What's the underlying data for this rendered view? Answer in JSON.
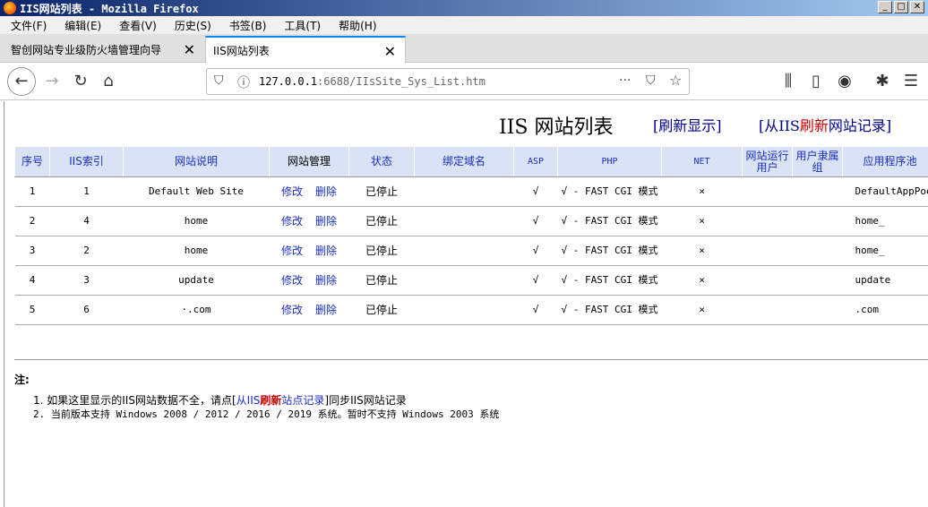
{
  "window": {
    "title": "IIS网站列表 - Mozilla Firefox",
    "min": "_",
    "max": "□",
    "close": "✕"
  },
  "menu": [
    "文件(F)",
    "编辑(E)",
    "查看(V)",
    "历史(S)",
    "书签(B)",
    "工具(T)",
    "帮助(H)"
  ],
  "tabs": [
    {
      "label": "智创网站专业级防火墙管理向导",
      "close": "✕"
    },
    {
      "label": "IIS网站列表",
      "close": "✕"
    }
  ],
  "newtab": "+",
  "nav": {
    "back": "←",
    "forward": "→",
    "reload": "↻",
    "home": "⌂",
    "url_host": "127.0.0.1",
    "url_rest": ":6688/IIsSite_Sys_List.htm",
    "more": "···",
    "pocket": "⛉",
    "star": "☆",
    "library": "⫼",
    "sidebar": "▯",
    "account": "◉",
    "gift": "✱",
    "menu": "☰"
  },
  "page": {
    "title": "IIS 网站列表",
    "refresh_link": "[刷新显示]",
    "sync_link_prefix": "[从IIS",
    "sync_link_red": "刷新",
    "sync_link_suffix": "网站记录]"
  },
  "table": {
    "headers": [
      "序号",
      "IIS索引",
      "网站说明",
      "网站管理",
      "状态",
      "绑定域名",
      "ASP",
      "PHP",
      "NET",
      "网站运行用户",
      "用户隶属组",
      "应用程序池"
    ],
    "edit_label": "修改",
    "delete_label": "删除",
    "rows": [
      {
        "no": "1",
        "iis": "1",
        "desc": "Default Web Site",
        "status": "已停止",
        "domain": "",
        "asp": "√",
        "php": "√ - FAST CGI 模式",
        "net": "×",
        "user": "",
        "group": "",
        "pool": "DefaultAppPool"
      },
      {
        "no": "2",
        "iis": "4",
        "desc": "home",
        "status": "已停止",
        "domain": "",
        "asp": "√",
        "php": "√ - FAST CGI 模式",
        "net": "×",
        "user": "",
        "group": "",
        "pool": "home_"
      },
      {
        "no": "3",
        "iis": "2",
        "desc": "home",
        "status": "已停止",
        "domain": "",
        "asp": "√",
        "php": "√ - FAST CGI 模式",
        "net": "×",
        "user": "",
        "group": "",
        "pool": "home_"
      },
      {
        "no": "4",
        "iis": "3",
        "desc": "update",
        "status": "已停止",
        "domain": "",
        "asp": "√",
        "php": "√ - FAST CGI 模式",
        "net": "×",
        "user": "",
        "group": "",
        "pool": "update"
      },
      {
        "no": "5",
        "iis": "6",
        "desc": "·.com",
        "status": "已停止",
        "domain": "",
        "asp": "√",
        "php": "√ - FAST CGI 模式",
        "net": "×",
        "user": "",
        "group": "",
        "pool": ".com"
      }
    ]
  },
  "notes": {
    "heading": "注:",
    "item1_prefix": "1. 如果这里显示的IIS网站数据不全，请点[",
    "item1_link_a": "从IIS",
    "item1_link_red": "刷新",
    "item1_link_b": "站点记录",
    "item1_suffix": "]同步IIS网站记录",
    "item2": "2. 当前版本支持 Windows 2008 / 2012 / 2016 / 2019 系统。暂时不支持 Windows 2003 系统"
  }
}
